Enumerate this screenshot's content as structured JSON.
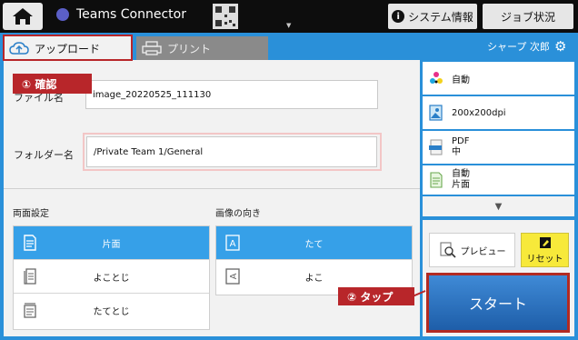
{
  "topbar": {
    "app_title": "Teams Connector",
    "system_info_label": "システム情報",
    "job_status_label": "ジョブ状況"
  },
  "tabs": {
    "upload_label": "アップロード",
    "print_label": "プリント"
  },
  "user": {
    "name": "シャープ 次郎"
  },
  "form": {
    "filename_label": "ファイル名",
    "filename_value": "image_20220525_111130",
    "folder_label": "フォルダー名",
    "folder_value": "/Private Team 1/General"
  },
  "duplex": {
    "title": "両面設定",
    "options": [
      "片面",
      "よことじ",
      "たてとじ"
    ],
    "selected": "片面"
  },
  "orientation": {
    "title": "画像の向き",
    "options": [
      "たて",
      "よこ"
    ],
    "selected": "たて"
  },
  "settings": {
    "color_mode": "自動",
    "resolution": "200x200dpi",
    "format_line1": "PDF",
    "format_line2": "中",
    "original_line1": "自動",
    "original_line2": "片面"
  },
  "actions": {
    "preview_label": "プレビュー",
    "reset_label": "リセット",
    "start_label": "スタート"
  },
  "annotations": {
    "confirm_label": "① 確認",
    "tap_label": "② タップ"
  },
  "colors": {
    "accent_blue": "#2a90d9",
    "selected_blue": "#36a0e8",
    "highlight_red": "#b8262a",
    "reset_yellow": "#f7e93a"
  }
}
